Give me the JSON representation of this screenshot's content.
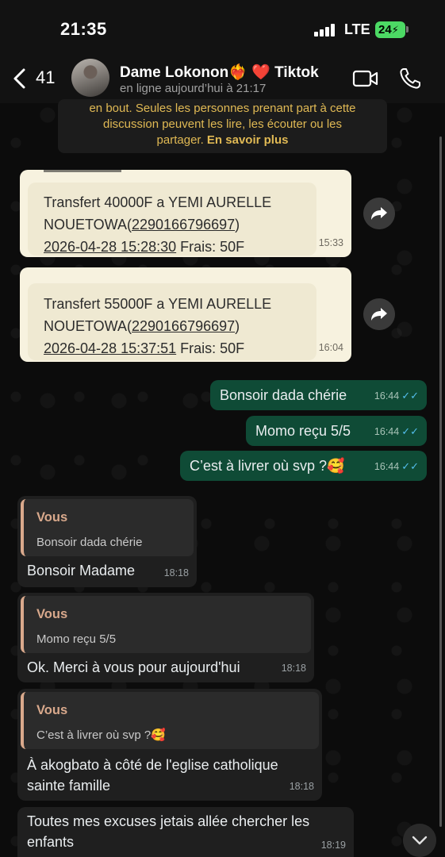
{
  "status_bar": {
    "time": "21:35",
    "network": "LTE",
    "battery": "24"
  },
  "header": {
    "back_count": "41",
    "contact_name": "Dame Lokonon❤️‍🔥 ❤️ Tiktok",
    "contact_status": "en ligne aujourd’hui à 21:17"
  },
  "notice": {
    "line1": "en bout. Seules les personnes prenant part à cette",
    "line2": "discussion peuvent les lire, les écouter ou les",
    "line3": "partager.",
    "link": "En savoir plus"
  },
  "messages": [
    {
      "type": "card",
      "line1": "Transfert 40000F a YEMI AURELLE",
      "line2a": "NOUETOWA(",
      "phone": "2290166796697",
      "line2b": ")",
      "date": "2026-04-28 15:28:30",
      "fee": " Frais: 50F",
      "time": "15:33"
    },
    {
      "type": "card",
      "line1": "Transfert 55000F a YEMI AURELLE",
      "line2a": "NOUETOWA(",
      "phone": "2290166796697",
      "line2b": ")",
      "date": "2026-04-28 15:37:51",
      "fee": " Frais: 50F",
      "time": "16:04"
    },
    {
      "type": "out",
      "text": "Bonsoir dada chérie",
      "time": "16:44"
    },
    {
      "type": "out",
      "text": "Momo reçu 5/5",
      "time": "16:44"
    },
    {
      "type": "out",
      "text": "C’est à livrer où svp ?🥰",
      "time": "16:44"
    },
    {
      "type": "in",
      "quote_author": "Vous",
      "quote_text": "Bonsoir dada chérie",
      "text": "Bonsoir Madame",
      "time": "18:18"
    },
    {
      "type": "in",
      "quote_author": "Vous",
      "quote_text": "Momo reçu 5/5",
      "text": "Ok. Merci à vous pour aujourd'hui",
      "time": "18:18"
    },
    {
      "type": "in",
      "quote_author": "Vous",
      "quote_text": "C’est à livrer où svp ?🥰",
      "line1": "À akogbato à côté de l'eglise catholique",
      "line2": "sainte famille",
      "time": "18:18"
    },
    {
      "type": "in",
      "line1": "Toutes mes excuses jetais allée chercher les",
      "line2": "enfants",
      "time": "18:19"
    }
  ],
  "ticks": "✓✓"
}
